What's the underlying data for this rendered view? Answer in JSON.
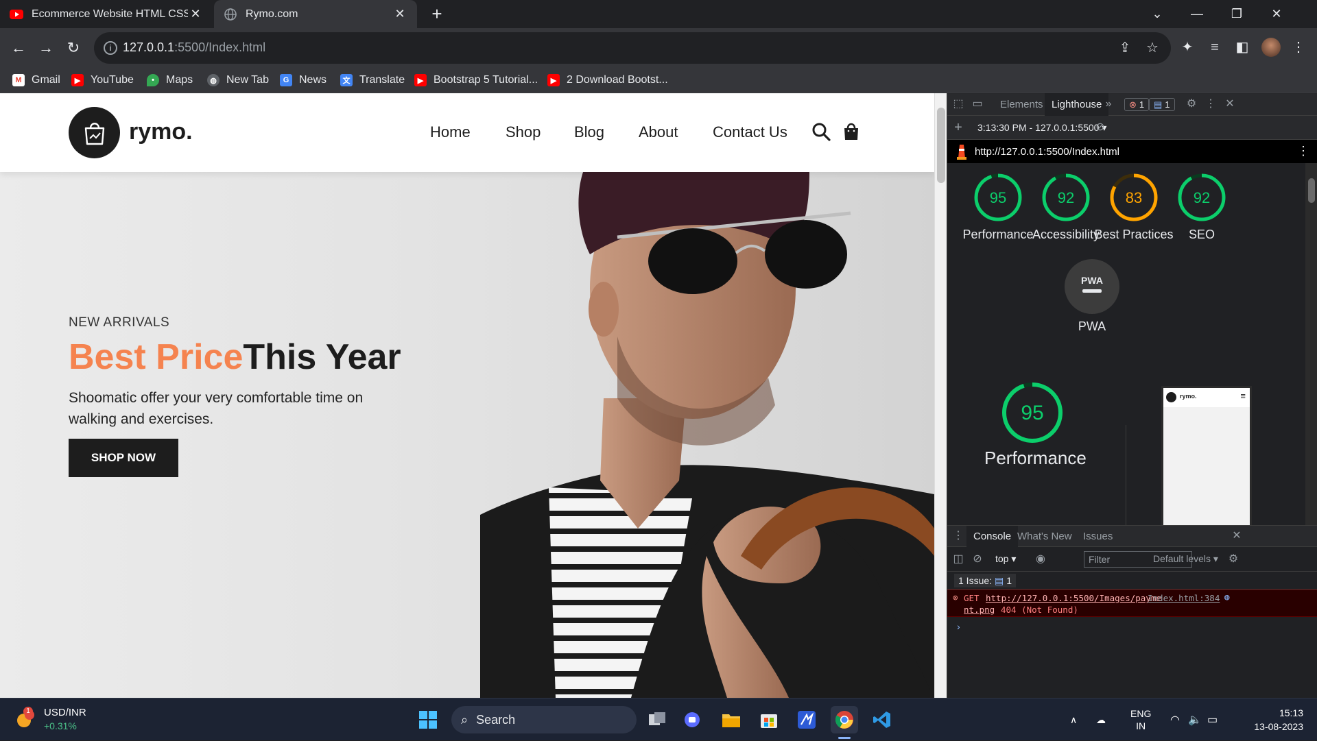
{
  "browser": {
    "tabs": [
      {
        "title": "Ecommerce Website HTML CSS |",
        "icon": "youtube-icon",
        "active": false
      },
      {
        "title": "Rymo.com",
        "icon": "globe-icon",
        "active": true
      }
    ],
    "url_host": "127.0.0.1",
    "url_rest": ":5500/Index.html",
    "bookmarks": [
      {
        "label": "Gmail",
        "icon": "gmail-icon"
      },
      {
        "label": "YouTube",
        "icon": "youtube-icon"
      },
      {
        "label": "Maps",
        "icon": "maps-icon"
      },
      {
        "label": "New Tab",
        "icon": "globe-icon"
      },
      {
        "label": "News",
        "icon": "news-icon"
      },
      {
        "label": "Translate",
        "icon": "translate-icon"
      },
      {
        "label": "Bootstrap 5 Tutorial...",
        "icon": "youtube-icon"
      },
      {
        "label": "2 Download Bootst...",
        "icon": "youtube-icon"
      }
    ]
  },
  "site": {
    "logo_text": "rymo.",
    "nav": [
      "Home",
      "Shop",
      "Blog",
      "About",
      "Contact Us"
    ],
    "hero": {
      "subtitle": "NEW ARRIVALS",
      "title_accent": "Best Price",
      "title_rest": "This Year",
      "description": "Shoomatic offer your very comfortable time on walking and exercises.",
      "button": "SHOP NOW"
    },
    "accent_color": "#f5834f"
  },
  "devtools": {
    "tabs": [
      "Elements",
      "Lighthouse"
    ],
    "error_count": "1",
    "message_count": "1",
    "lighthouse_run": "3:13:30 PM - 127.0.0.1:5500",
    "report_url": "http://127.0.0.1:5500/Index.html",
    "scores": [
      {
        "label": "Performance",
        "score": 95,
        "color": "#0cce6b"
      },
      {
        "label": "Accessibility",
        "score": 92,
        "color": "#0cce6b"
      },
      {
        "label": "Best Practices",
        "score": 83,
        "color": "#ffa400"
      },
      {
        "label": "SEO",
        "score": 92,
        "color": "#0cce6b"
      }
    ],
    "pwa_label": "PWA",
    "pwa_badge": "PWA",
    "perf_big_score": 95,
    "perf_big_label": "Performance",
    "thumb_logo": "rymo.",
    "console_tabs": [
      "Console",
      "What's New",
      "Issues"
    ],
    "context": "top",
    "filter_placeholder": "Filter",
    "levels": "Default levels",
    "issues_label": "1 Issue:",
    "issues_count": "1",
    "error": {
      "method": "GET",
      "url_line1": "http://127.0.0.1:5500/Images/payme",
      "url_line2": "nt.png",
      "status": "404 (Not Found)",
      "source": "Index.html:384"
    }
  },
  "taskbar": {
    "ticker_name": "USD/INR",
    "ticker_change": "+0.31%",
    "ticker_badge": "1",
    "search_label": "Search",
    "lang": "ENG",
    "region": "IN",
    "time": "15:13",
    "date": "13-08-2023"
  }
}
